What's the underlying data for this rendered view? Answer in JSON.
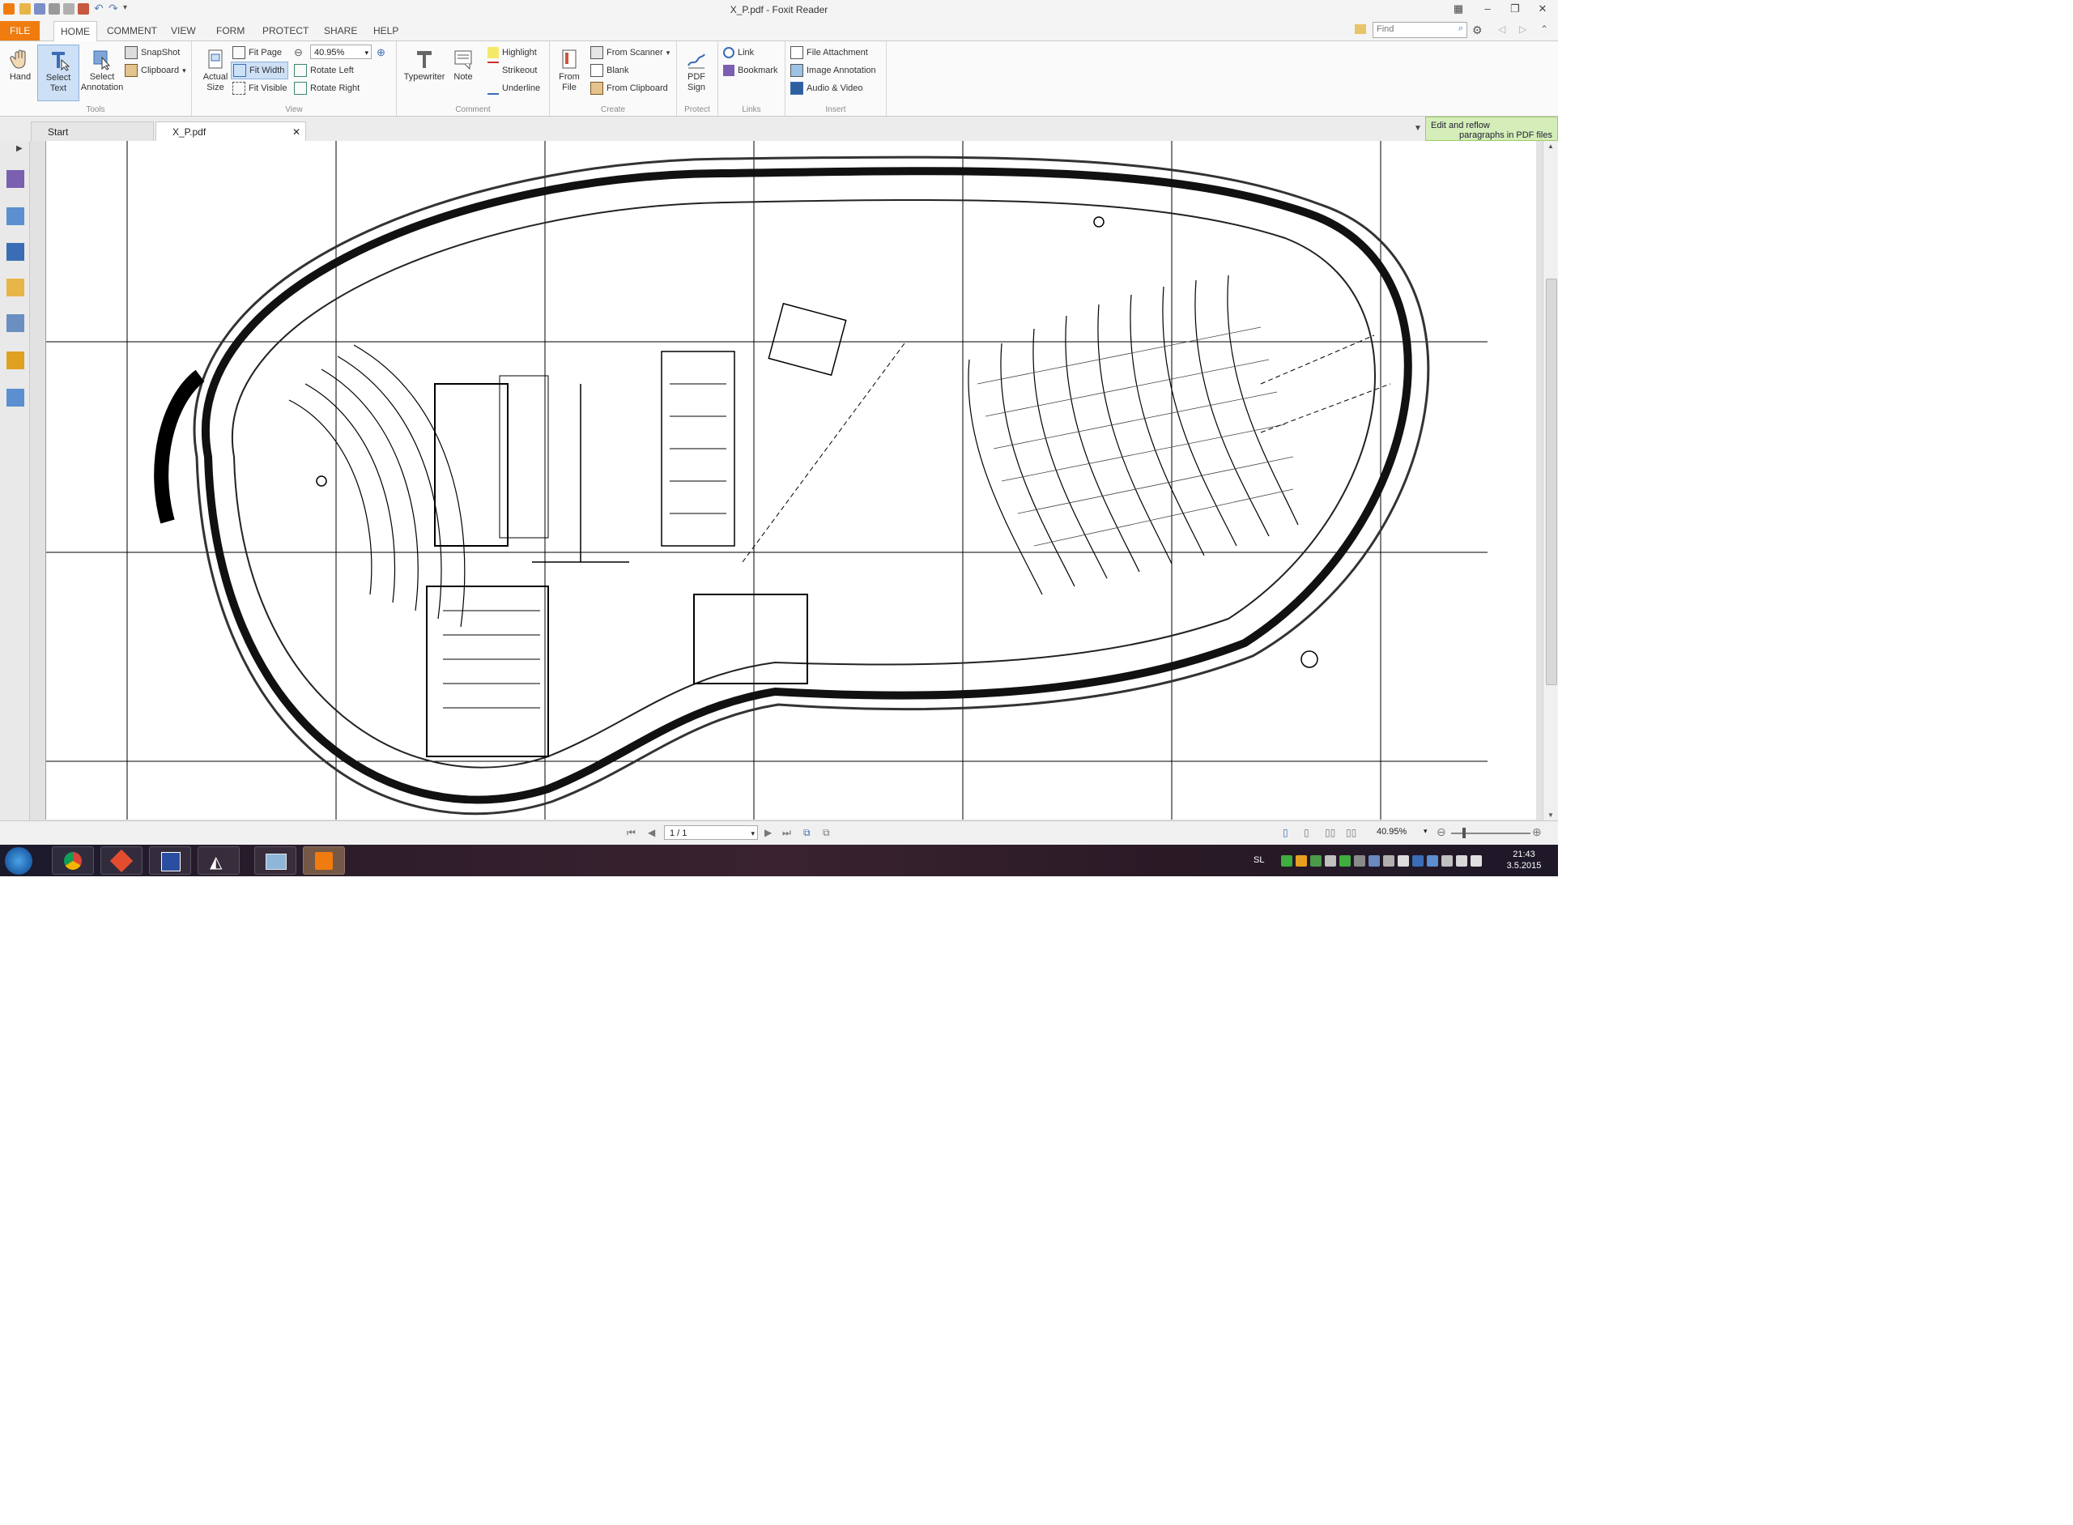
{
  "window": {
    "title": "X_P.pdf - Foxit Reader"
  },
  "tabs": [
    "FILE",
    "HOME",
    "COMMENT",
    "VIEW",
    "FORM",
    "PROTECT",
    "SHARE",
    "HELP"
  ],
  "search": {
    "placeholder": "Find"
  },
  "ribbon": {
    "tools": {
      "label": "Tools",
      "hand": "Hand",
      "select_text_1": "Select",
      "select_text_2": "Text",
      "select_annot_1": "Select",
      "select_annot_2": "Annotation",
      "snapshot": "SnapShot",
      "clipboard": "Clipboard"
    },
    "view": {
      "label": "View",
      "actual_size_1": "Actual",
      "actual_size_2": "Size",
      "fit_page": "Fit Page",
      "fit_width": "Fit Width",
      "fit_visible": "Fit Visible",
      "zoom": "40.95%",
      "rotate_left": "Rotate Left",
      "rotate_right": "Rotate Right"
    },
    "comment": {
      "label": "Comment",
      "typewriter": "Typewriter",
      "note": "Note",
      "highlight": "Highlight",
      "strikeout": "Strikeout",
      "underline": "Underline"
    },
    "create": {
      "label": "Create",
      "from_file_1": "From",
      "from_file_2": "File",
      "from_scanner": "From Scanner",
      "blank": "Blank",
      "from_clipboard": "From Clipboard"
    },
    "protect": {
      "label": "Protect",
      "pdf_sign_1": "PDF",
      "pdf_sign_2": "Sign"
    },
    "links": {
      "label": "Links",
      "link": "Link",
      "bookmark": "Bookmark"
    },
    "insert": {
      "label": "Insert",
      "file_attachment": "File Attachment",
      "image_annotation": "Image Annotation",
      "audio_video": "Audio & Video"
    }
  },
  "doc_tabs": [
    "Start",
    "X_P.pdf"
  ],
  "promo": {
    "line1": "Edit and reflow",
    "line2": "paragraphs in PDF files"
  },
  "status": {
    "page": "1 / 1",
    "zoom": "40.95%"
  },
  "taskbar": {
    "lang": "SL",
    "time": "21:43",
    "date": "3.5.2015"
  },
  "colors": {
    "file_tab": "#f07b0f",
    "selection": "#cde0f6",
    "promo_bg": "#d4edb9"
  },
  "icons": [
    "hand-icon",
    "select-text-icon",
    "select-annotation-icon",
    "snapshot-icon",
    "clipboard-icon",
    "actual-size-icon",
    "fit-page-icon",
    "fit-width-icon",
    "fit-visible-icon",
    "zoom-in-icon",
    "rotate-left-icon",
    "rotate-right-icon",
    "typewriter-icon",
    "note-icon",
    "highlight-icon",
    "strikeout-icon",
    "underline-icon",
    "from-file-icon",
    "scanner-icon",
    "blank-icon",
    "clipboard-create-icon",
    "pdf-sign-icon",
    "link-icon",
    "bookmark-icon",
    "file-attachment-icon",
    "image-annotation-icon",
    "audio-video-icon"
  ]
}
